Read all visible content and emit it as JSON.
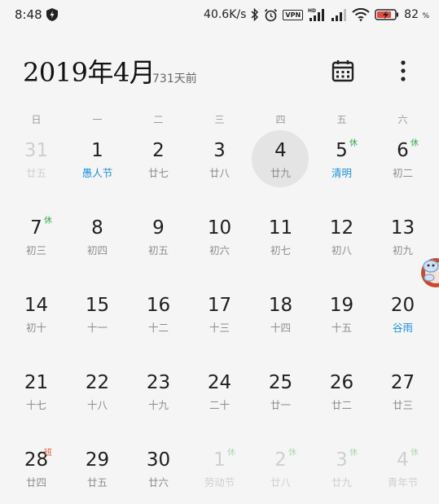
{
  "status_bar": {
    "time": "8:48",
    "speed": "40.6K/s",
    "vpn": "VPN",
    "battery_pct": "82",
    "battery_unit": "%"
  },
  "header": {
    "title": "2019年4月",
    "days_ago": "731天前"
  },
  "weekdays": [
    "日",
    "一",
    "二",
    "三",
    "四",
    "五",
    "六"
  ],
  "weeks": [
    [
      {
        "day": "31",
        "lunar": "廿五",
        "dim": true
      },
      {
        "day": "1",
        "lunar": "愚人节",
        "blue": true
      },
      {
        "day": "2",
        "lunar": "廿七"
      },
      {
        "day": "3",
        "lunar": "廿八"
      },
      {
        "day": "4",
        "lunar": "廿九",
        "today": true
      },
      {
        "day": "5",
        "lunar": "清明",
        "blue": true,
        "badge": "休"
      },
      {
        "day": "6",
        "lunar": "初二",
        "badge": "休"
      }
    ],
    [
      {
        "day": "7",
        "lunar": "初三",
        "badge": "休"
      },
      {
        "day": "8",
        "lunar": "初四"
      },
      {
        "day": "9",
        "lunar": "初五"
      },
      {
        "day": "10",
        "lunar": "初六"
      },
      {
        "day": "11",
        "lunar": "初七"
      },
      {
        "day": "12",
        "lunar": "初八"
      },
      {
        "day": "13",
        "lunar": "初九"
      }
    ],
    [
      {
        "day": "14",
        "lunar": "初十"
      },
      {
        "day": "15",
        "lunar": "十一"
      },
      {
        "day": "16",
        "lunar": "十二"
      },
      {
        "day": "17",
        "lunar": "十三"
      },
      {
        "day": "18",
        "lunar": "十四"
      },
      {
        "day": "19",
        "lunar": "十五"
      },
      {
        "day": "20",
        "lunar": "谷雨",
        "blue": true
      }
    ],
    [
      {
        "day": "21",
        "lunar": "十七"
      },
      {
        "day": "22",
        "lunar": "十八"
      },
      {
        "day": "23",
        "lunar": "十九"
      },
      {
        "day": "24",
        "lunar": "二十"
      },
      {
        "day": "25",
        "lunar": "廿一"
      },
      {
        "day": "26",
        "lunar": "廿二"
      },
      {
        "day": "27",
        "lunar": "廿三"
      }
    ],
    [
      {
        "day": "28",
        "lunar": "廿四",
        "badge": "班",
        "badge_type": "ban"
      },
      {
        "day": "29",
        "lunar": "廿五"
      },
      {
        "day": "30",
        "lunar": "廿六"
      },
      {
        "day": "1",
        "lunar": "劳动节",
        "dim": true,
        "badge": "休"
      },
      {
        "day": "2",
        "lunar": "廿八",
        "dim": true,
        "badge": "休"
      },
      {
        "day": "3",
        "lunar": "廿九",
        "dim": true,
        "badge": "休"
      },
      {
        "day": "4",
        "lunar": "青年节",
        "dim": true,
        "badge": "休"
      }
    ]
  ],
  "colors": {
    "holiday_text": "#1a90d8",
    "rest_badge": "#33a74a",
    "work_badge": "#e0573a",
    "today_bg": "#e4e4e4"
  },
  "icons": [
    "shield-icon",
    "bluetooth-icon",
    "alarm-icon",
    "vpn-icon",
    "signal-icon",
    "wifi-icon",
    "battery-icon",
    "calendar-icon",
    "more-icon"
  ]
}
